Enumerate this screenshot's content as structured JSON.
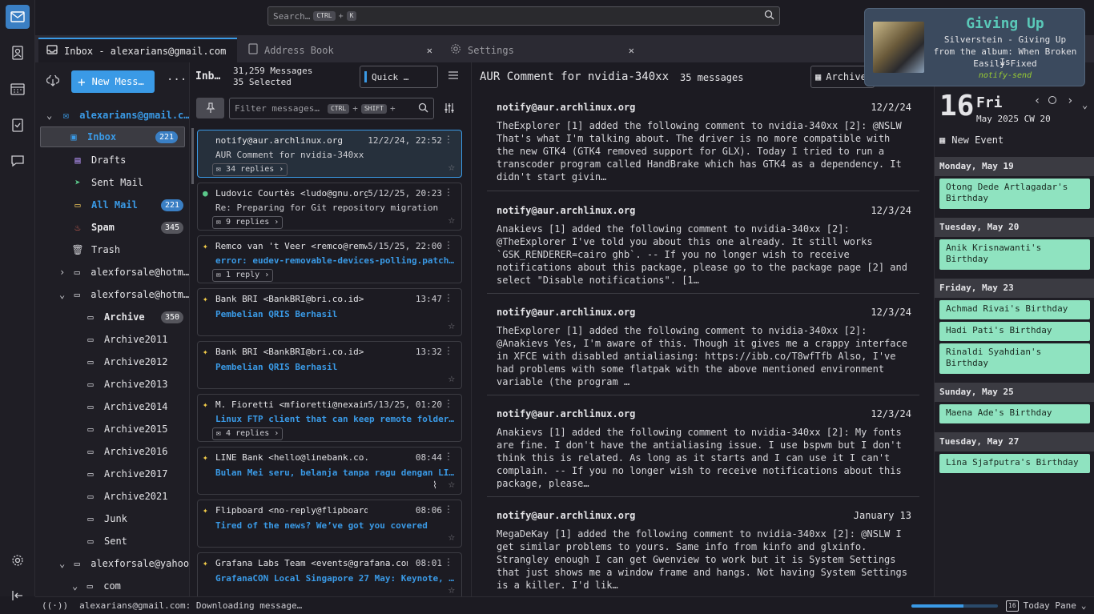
{
  "search": {
    "placeholder": "Search…",
    "shortcut_mod": "CTRL",
    "shortcut_plus": "+",
    "shortcut_key": "K"
  },
  "tabs": [
    {
      "label": "Inbox - alexarians@gmail.com"
    },
    {
      "label": "Address Book"
    },
    {
      "label": "Settings"
    }
  ],
  "folder_pane": {
    "new_message": "New Mess…",
    "account": "alexarians@gmail.c…",
    "folders": [
      {
        "name": "Inbox",
        "badge": "221",
        "icon": "inbox-icon"
      },
      {
        "name": "Drafts",
        "icon": "drafts-icon"
      },
      {
        "name": "Sent Mail",
        "icon": "sent-icon"
      },
      {
        "name": "All Mail",
        "badge": "221",
        "icon": "all-mail-icon"
      },
      {
        "name": "Spam",
        "badge": "345",
        "icon": "spam-icon"
      },
      {
        "name": "Trash",
        "icon": "trash-icon"
      },
      {
        "name": "alexforsale@hotm…",
        "icon": "folder-icon"
      },
      {
        "name": "alexforsale@hotm…",
        "icon": "folder-icon"
      },
      {
        "name": "Archive",
        "badge": "350",
        "icon": "folder-icon"
      },
      {
        "name": "Archive2011",
        "icon": "folder-icon"
      },
      {
        "name": "Archive2012",
        "icon": "folder-icon"
      },
      {
        "name": "Archive2013",
        "icon": "folder-icon"
      },
      {
        "name": "Archive2014",
        "icon": "folder-icon"
      },
      {
        "name": "Archive2015",
        "icon": "folder-icon"
      },
      {
        "name": "Archive2016",
        "icon": "folder-icon"
      },
      {
        "name": "Archive2017",
        "icon": "folder-icon"
      },
      {
        "name": "Archive2021",
        "icon": "folder-icon"
      },
      {
        "name": "Junk",
        "icon": "folder-icon"
      },
      {
        "name": "Sent",
        "icon": "folder-icon"
      },
      {
        "name": "alexforsale@yahoo",
        "icon": "folder-icon"
      },
      {
        "name": "com",
        "icon": "folder-icon"
      }
    ]
  },
  "thread_pane": {
    "folder": "Inb…",
    "count": "31,259 Messages",
    "selected": "35 Selected",
    "quick_filter": "Quick …",
    "filter_placeholder": "Filter messages…",
    "filter_mod": "CTRL",
    "filter_shift": "SHIFT",
    "filter_plus": "+",
    "threads": [
      {
        "from": "notify@aur.archlinux.org",
        "date": "12/2/24, 22:52",
        "subject": "AUR Comment for nvidia-340xx",
        "replies": "34 replies"
      },
      {
        "from": "Ludovic Courtès <ludo@gnu.org>",
        "date": "5/12/25, 20:23",
        "subject": "Re: Preparing for Git repository migration",
        "replies": "9 replies"
      },
      {
        "from": "Remco van 't Veer <remco@remwo…",
        "date": "5/15/25, 22:00",
        "subject": "error: eudev-removable-devices-polling.patch: …",
        "replies": "1 reply"
      },
      {
        "from": "Bank BRI <BankBRI@bri.co.id>",
        "date": "13:47",
        "subject": "Pembelian QRIS Berhasil"
      },
      {
        "from": "Bank BRI <BankBRI@bri.co.id>",
        "date": "13:32",
        "subject": "Pembelian QRIS Berhasil"
      },
      {
        "from": "M. Fioretti <mfioretti@nexaima…",
        "date": "5/13/25, 01:20",
        "subject": "Linux FTP client that can keep remote folder i…",
        "replies": "4 replies"
      },
      {
        "from": "LINE Bank <hello@linebank.co.id>",
        "date": "08:44",
        "subject": "Bulan Mei seru, belanja tanpa ragu dengan LINE…"
      },
      {
        "from": "Flipboard <no-reply@flipboard.com>",
        "date": "08:06",
        "subject": "Tired of the news? We’ve got you covered"
      },
      {
        "from": "Grafana Labs Team <events@grafana.com>",
        "date": "08:01",
        "subject": "GrafanaCON Local Singapore 27 May: Keynote, Ob…"
      }
    ]
  },
  "message_pane": {
    "subject": "AUR Comment for nvidia-340xx",
    "count": "35 messages",
    "archive": "Archive",
    "messages": [
      {
        "from": "notify@aur.archlinux.org",
        "date": "12/2/24",
        "body": "TheExplorer [1] added the following comment to nvidia-340xx [2]: @NSLW That's what I'm talking about. The driver is no more compatible with the new GTK4 (GTK4 removed support for GLX). Today I tried to run a transcoder program called HandBrake which has GTK4 as a dependency. It didn't start givin…"
      },
      {
        "from": "notify@aur.archlinux.org",
        "date": "12/3/24",
        "body": "Anakievs [1] added the following comment to nvidia-340xx [2]: @TheExplorer I've told you about this one already. It still works `GSK_RENDERER=cairo ghb`. -- If you no longer wish to receive notifications about this package, please go to the package page [2] and select \"Disable notifications\". [1…"
      },
      {
        "from": "notify@aur.archlinux.org",
        "date": "12/3/24",
        "body": "TheExplorer [1] added the following comment to nvidia-340xx [2]: @Anakievs Yes, I'm aware of this. Though it gives me a crappy interface in XFCE with disabled antialiasing: https://ibb.co/T8wfTfb Also, I've had problems with some flatpak with the above mentioned environment variable (the program …"
      },
      {
        "from": "notify@aur.archlinux.org",
        "date": "12/3/24",
        "body": "Anakievs [1] added the following comment to nvidia-340xx [2]: My fonts are fine. I don't have the antialiasing issue. I use bspwm but I don't think this is related. As long as it starts and I can use it I can't complain. -- If you no longer wish to receive notifications about this package, please…"
      },
      {
        "from": "notify@aur.archlinux.org",
        "date": "January 13",
        "body": "MegaDeKay [1] added the following comment to nvidia-340xx [2]: @NSLW I get similar problems to yours. Same info from kinfo and glxinfo. Strangley enough I can get Gwenview to work but it is System Settings that just shows me a window frame and hangs. Not having System Settings is a killer. I'd lik…"
      }
    ]
  },
  "today_pane": {
    "day_num": "16",
    "weekday": "Fri",
    "month_week": "May 2025 CW 20",
    "new_event": "New Event",
    "days": [
      {
        "header": "Monday, May 19",
        "events": [
          "Otong Dede Artlagadar's Birthday"
        ]
      },
      {
        "header": "Tuesday, May 20",
        "events": [
          "Anik Krisnawanti's Birthday"
        ]
      },
      {
        "header": "Friday, May 23",
        "events": [
          "Achmad Rivai's Birthday",
          "Hadi Pati's Birthday",
          "Rinaldi Syahdian's Birthday"
        ]
      },
      {
        "header": "Sunday, May 25",
        "events": [
          "Maena Ade's Birthday"
        ]
      },
      {
        "header": "Tuesday, May 27",
        "events": [
          "Lina Sjafputra's Birthday"
        ]
      }
    ]
  },
  "status": {
    "text": "alexarians@gmail.com: Downloading message…",
    "today_pane": "Today Pane",
    "today_num": "16"
  },
  "notification": {
    "title": "Giving Up",
    "line1": "Silverstein - Giving Up",
    "line2": "from the album: When Broken Is",
    "line3": "Easily Fixed",
    "app": "notify-send"
  },
  "colors": {
    "accent": "#3a9ae6",
    "event": "#8fe3c0"
  }
}
